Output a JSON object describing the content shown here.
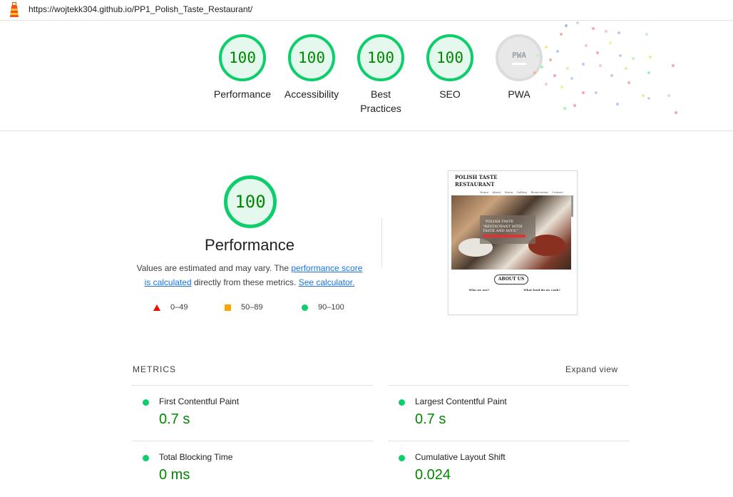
{
  "url": "https://wojtekk304.github.io/PP1_Polish_Taste_Restaurant/",
  "colors": {
    "pass": "#0cce6b",
    "pass_text": "#008800",
    "average": "#ffa400",
    "fail": "#eb0f00",
    "link": "#1a73e8"
  },
  "gauges": [
    {
      "score": "100",
      "label": "Performance"
    },
    {
      "score": "100",
      "label": "Accessibility"
    },
    {
      "score": "100",
      "label": "Best Practices"
    },
    {
      "score": "100",
      "label": "SEO"
    },
    {
      "badge": "PWA",
      "label": "PWA"
    }
  ],
  "performance": {
    "score": "100",
    "title": "Performance",
    "desc_pre": "Values are estimated and may vary. The ",
    "link1": "performance score is calculated",
    "desc_mid": " directly from these metrics. ",
    "link2": "See calculator.",
    "legend": [
      "0–49",
      "50–89",
      "90–100"
    ]
  },
  "thumbnail": {
    "site_title": "POLISH TASTE RESTAURANT",
    "nav": "Home About Menu Gallery Reservation Contact",
    "hero_line1": "POLISH TASTE",
    "hero_line2": "\"RESTAURANT WITH TASTE AND SOUL\"",
    "about_button": "ABOUT US",
    "col1_title": "Who we are?",
    "col2_title": "What food do we cook?"
  },
  "metrics": {
    "heading": "METRICS",
    "expand": "Expand view",
    "items": [
      {
        "name": "First Contentful Paint",
        "value": "0.7 s"
      },
      {
        "name": "Largest Contentful Paint",
        "value": "0.7 s"
      },
      {
        "name": "Total Blocking Time",
        "value": "0 ms"
      },
      {
        "name": "Cumulative Layout Shift",
        "value": "0.024"
      }
    ]
  },
  "icons": [
    "lighthouse-logo-icon",
    "pass-circle-icon",
    "fail-triangle-icon",
    "average-square-icon"
  ]
}
